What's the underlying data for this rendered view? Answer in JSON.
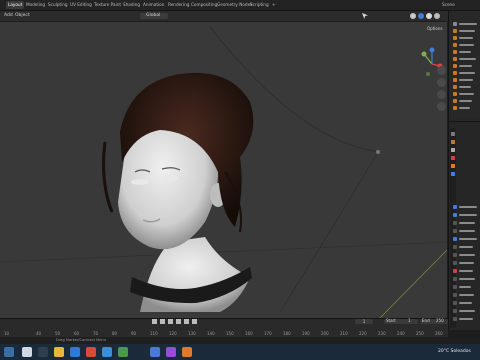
{
  "app": {
    "title": "Blender"
  },
  "workspace_tabs": [
    "Layout",
    "Modeling",
    "Sculpting",
    "UV Editing",
    "Texture Paint",
    "Shading",
    "Animation",
    "Rendering",
    "Compositing",
    "Geometry Nodes",
    "Scripting"
  ],
  "active_tab": "Layout",
  "header": {
    "add_label": "Add",
    "object_label": "Object",
    "orientation_label": "Global",
    "scene_label": "Scene",
    "options_label": "Options"
  },
  "timeline": {
    "ticks": [
      "10",
      "40",
      "50",
      "60",
      "70",
      "80",
      "90",
      "110",
      "120",
      "130",
      "140",
      "150",
      "160",
      "170",
      "180",
      "190",
      "200",
      "210",
      "220",
      "230",
      "240",
      "250",
      "260"
    ],
    "start_label": "Start",
    "start_value": "1",
    "end_label": "End",
    "end_value": "250",
    "current_frame": "1"
  },
  "status": {
    "message": "Drag Marker/Contract Menu"
  },
  "taskbar": {
    "weather": "20°C  Soleados",
    "colors": {
      "bg": "#1b2a3a"
    }
  },
  "colors": {
    "accent": "#3f7fd8",
    "bg": "#393939"
  }
}
